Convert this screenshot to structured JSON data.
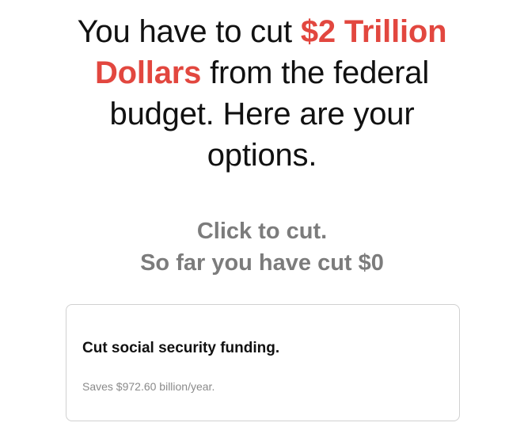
{
  "headline": {
    "line1_before": "You have to cut ",
    "line1_accent": "$2 Trillion",
    "line2_accent": "Dollars",
    "line2_after": " from the federal",
    "line3": "budget. Here are your",
    "line4": "options."
  },
  "subhead": {
    "line1": "Click to cut.",
    "line2": "So far you have cut $0"
  },
  "options": [
    {
      "title": "Cut social security funding.",
      "savings": "Saves $972.60 billion/year."
    }
  ],
  "colors": {
    "accent": "#e2473f",
    "muted_heading": "#7c7c7c",
    "card_border": "#d0d0d0"
  }
}
